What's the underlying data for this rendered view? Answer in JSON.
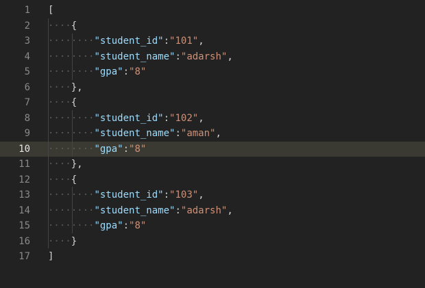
{
  "editor": {
    "colors": {
      "background": "#222222",
      "active_line": "#3b3a32",
      "key": "#9cdcfe",
      "string": "#ce9178",
      "punctuation": "#d4d4d4",
      "line_number": "#8a8a8a",
      "active_line_number": "#e6e6e6"
    },
    "active_line": 10,
    "lines": [
      {
        "num": "1",
        "ws": "",
        "parts": [
          {
            "t": "punc",
            "v": "["
          }
        ]
      },
      {
        "num": "2",
        "ws": "····",
        "parts": [
          {
            "t": "punc",
            "v": "{"
          }
        ]
      },
      {
        "num": "3",
        "ws": "········",
        "parts": [
          {
            "t": "key",
            "v": "\"student_id\""
          },
          {
            "t": "punc",
            "v": ":"
          },
          {
            "t": "str",
            "v": "\"101\""
          },
          {
            "t": "punc",
            "v": ","
          }
        ]
      },
      {
        "num": "4",
        "ws": "········",
        "parts": [
          {
            "t": "key",
            "v": "\"student_name\""
          },
          {
            "t": "punc",
            "v": ":"
          },
          {
            "t": "str",
            "v": "\"adarsh\""
          },
          {
            "t": "punc",
            "v": ","
          }
        ]
      },
      {
        "num": "5",
        "ws": "········",
        "parts": [
          {
            "t": "key",
            "v": "\"gpa\""
          },
          {
            "t": "punc",
            "v": ":"
          },
          {
            "t": "str",
            "v": "\"8\""
          }
        ]
      },
      {
        "num": "6",
        "ws": "····",
        "parts": [
          {
            "t": "punc",
            "v": "},"
          }
        ]
      },
      {
        "num": "7",
        "ws": "····",
        "parts": [
          {
            "t": "punc",
            "v": "{"
          }
        ]
      },
      {
        "num": "8",
        "ws": "········",
        "parts": [
          {
            "t": "key",
            "v": "\"student_id\""
          },
          {
            "t": "punc",
            "v": ":"
          },
          {
            "t": "str",
            "v": "\"102\""
          },
          {
            "t": "punc",
            "v": ","
          }
        ]
      },
      {
        "num": "9",
        "ws": "········",
        "parts": [
          {
            "t": "key",
            "v": "\"student_name\""
          },
          {
            "t": "punc",
            "v": ":"
          },
          {
            "t": "str",
            "v": "\"aman\""
          },
          {
            "t": "punc",
            "v": ","
          }
        ]
      },
      {
        "num": "10",
        "ws": "········",
        "parts": [
          {
            "t": "key",
            "v": "\"gpa\""
          },
          {
            "t": "punc",
            "v": ":"
          },
          {
            "t": "str",
            "v": "\"8\""
          }
        ]
      },
      {
        "num": "11",
        "ws": "····",
        "parts": [
          {
            "t": "punc",
            "v": "},"
          }
        ]
      },
      {
        "num": "12",
        "ws": "····",
        "parts": [
          {
            "t": "punc",
            "v": "{"
          }
        ]
      },
      {
        "num": "13",
        "ws": "········",
        "parts": [
          {
            "t": "key",
            "v": "\"student_id\""
          },
          {
            "t": "punc",
            "v": ":"
          },
          {
            "t": "str",
            "v": "\"103\""
          },
          {
            "t": "punc",
            "v": ","
          }
        ]
      },
      {
        "num": "14",
        "ws": "········",
        "parts": [
          {
            "t": "key",
            "v": "\"student_name\""
          },
          {
            "t": "punc",
            "v": ":"
          },
          {
            "t": "str",
            "v": "\"adarsh\""
          },
          {
            "t": "punc",
            "v": ","
          }
        ]
      },
      {
        "num": "15",
        "ws": "········",
        "parts": [
          {
            "t": "key",
            "v": "\"gpa\""
          },
          {
            "t": "punc",
            "v": ":"
          },
          {
            "t": "str",
            "v": "\"8\""
          }
        ]
      },
      {
        "num": "16",
        "ws": "····",
        "parts": [
          {
            "t": "punc",
            "v": "}"
          }
        ]
      },
      {
        "num": "17",
        "ws": "",
        "parts": [
          {
            "t": "punc",
            "v": "]"
          }
        ]
      }
    ]
  }
}
